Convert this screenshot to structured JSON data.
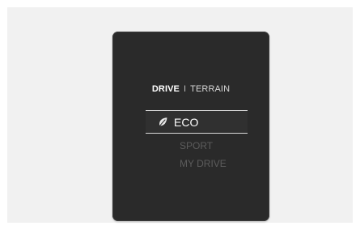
{
  "header": {
    "active_tab": "DRIVE",
    "separator": "I",
    "inactive_tab": "TERRAIN"
  },
  "modes": {
    "selected": {
      "label": "ECO",
      "icon": "leaf-icon"
    },
    "others": [
      {
        "label": "SPORT"
      },
      {
        "label": "MY DRIVE"
      }
    ]
  },
  "colors": {
    "screen_background": "#2a2a2a",
    "selected_text": "#ffffff",
    "dim_text": "#5c5c5c"
  }
}
